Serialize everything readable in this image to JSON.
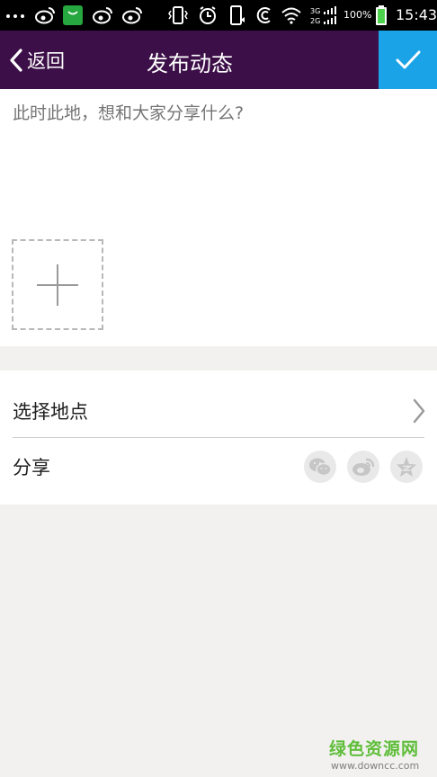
{
  "status_bar": {
    "battery_percent": "100%",
    "time": "15:43",
    "icons": [
      "more-dots-icon",
      "weibo-icon",
      "store-bag-icon",
      "weibo-icon",
      "weibo-icon",
      "vibrate-icon",
      "alarm-icon",
      "phone-icon",
      "nfc-icon",
      "wifi-icon",
      "signal-3g-2g-icon",
      "battery-icon"
    ]
  },
  "header": {
    "back_label": "返回",
    "title": "发布动态",
    "confirm_icon": "check-icon"
  },
  "compose": {
    "placeholder": "此时此地，想和大家分享什么?",
    "add_image_icon": "plus-icon"
  },
  "options": {
    "location_label": "选择地点",
    "share_label": "分享",
    "share_targets": [
      "wechat-icon",
      "weibo-icon",
      "qzone-star-icon"
    ]
  },
  "watermark": {
    "title": "绿色资源网",
    "url": "www.downcc.com"
  },
  "colors": {
    "header_bg": "#3d0f48",
    "confirm_bg": "#1aa3e6",
    "page_bg": "#f2f1ef",
    "watermark_green": "#5fbe3a"
  }
}
